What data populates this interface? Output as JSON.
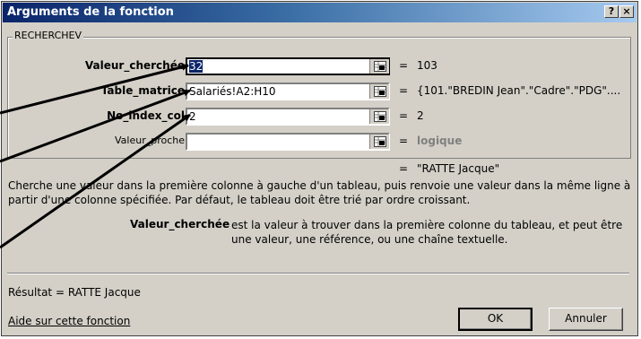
{
  "window": {
    "title": "Arguments de la fonction",
    "help_button": "?",
    "close_button": "×"
  },
  "group": {
    "label": "RECHERCHEV"
  },
  "args": [
    {
      "label": "Valeur_cherchée",
      "value": "32",
      "result": "103"
    },
    {
      "label": "Table_matrice",
      "value": "Salariés!A2:H10",
      "result": "{101.\"BREDIN Jean\".\"Cadre\".\"PDG\"...."
    },
    {
      "label": "No_index_col",
      "value": "2",
      "result": "2"
    },
    {
      "label": "Valeur_proche",
      "value": "",
      "result": "logique"
    }
  ],
  "formula_result": "\"RATTE Jacque\"",
  "description": "Cherche une valeur dans la première colonne à gauche d'un tableau, puis renvoie une valeur dans la même ligne à partir d'une colonne spécifiée. Par défaut, le tableau doit être trié par ordre croissant.",
  "param_help": {
    "name": "Valeur_cherchée",
    "text": "est la valeur à trouver dans la première colonne du tableau, et peut être une valeur, une référence, ou une chaîne textuelle."
  },
  "resultat": "Résultat =  RATTE Jacque",
  "help_link": "Aide sur cette fonction",
  "buttons": {
    "ok": "OK",
    "cancel": "Annuler"
  },
  "equals_sign": "=",
  "icons": {
    "refedit": "collapse-dialog-icon"
  },
  "colors": {
    "titlebar_start": "#0a246a",
    "titlebar_end": "#a6caf0",
    "dialog_bg": "#d4d0c8",
    "selection": "#0a246a"
  }
}
